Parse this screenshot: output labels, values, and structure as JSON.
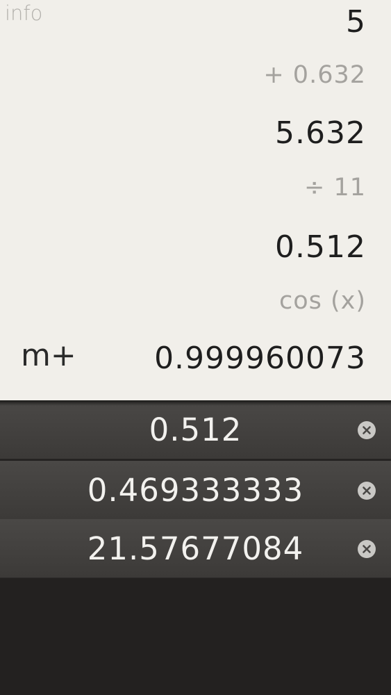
{
  "header": {
    "info_label": "info"
  },
  "tape": {
    "lines": [
      {
        "kind": "result",
        "text": "5"
      },
      {
        "kind": "operation",
        "text": "+ 0.632"
      },
      {
        "kind": "result",
        "text": "5.632"
      },
      {
        "kind": "operation",
        "text": "÷ 11"
      },
      {
        "kind": "result",
        "text": "0.512"
      },
      {
        "kind": "operation",
        "text": "cos (x)"
      },
      {
        "kind": "result",
        "text": "0.999960073"
      }
    ],
    "memory_add_label": "m+"
  },
  "memory": {
    "items": [
      {
        "value": "0.512",
        "delete_icon": "close-circle-icon"
      },
      {
        "value": "0.469333333",
        "delete_icon": "close-circle-icon"
      },
      {
        "value": "21.57677084",
        "delete_icon": "close-circle-icon"
      }
    ]
  },
  "colors": {
    "tape_background": "#f1efea",
    "memory_background": "#232120",
    "row_background": "#444240",
    "result_text": "#1e1e1e",
    "operation_text": "#a4a29e"
  }
}
